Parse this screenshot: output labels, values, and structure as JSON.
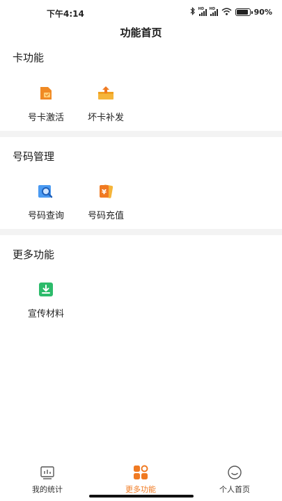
{
  "status_bar": {
    "time": "下午4:14",
    "battery_percent": "90%",
    "battery_level": 0.9,
    "icons": [
      "bluetooth-icon",
      "signal-icon",
      "signal-icon",
      "wifi-icon",
      "battery-icon"
    ]
  },
  "header": {
    "title": "功能首页"
  },
  "sections": [
    {
      "title": "卡功能",
      "items": [
        {
          "label": "号卡激活",
          "icon": "card-activate-icon",
          "color": "#f08a24"
        },
        {
          "label": "坏卡补发",
          "icon": "card-reissue-icon",
          "color": "#f5a623"
        }
      ]
    },
    {
      "title": "号码管理",
      "items": [
        {
          "label": "号码查询",
          "icon": "number-search-icon",
          "color": "#3d8ef0"
        },
        {
          "label": "号码充值",
          "icon": "number-recharge-icon",
          "color": "#f08a24"
        }
      ]
    },
    {
      "title": "更多功能",
      "items": [
        {
          "label": "宣传材料",
          "icon": "download-icon",
          "color": "#2dbb6b"
        }
      ]
    }
  ],
  "tab_bar": {
    "tabs": [
      {
        "label": "我的统计",
        "icon": "statistics-icon",
        "active": false
      },
      {
        "label": "更多功能",
        "icon": "more-functions-icon",
        "active": true
      },
      {
        "label": "个人首页",
        "icon": "profile-icon",
        "active": false
      }
    ],
    "accent_color": "#f07a22"
  }
}
